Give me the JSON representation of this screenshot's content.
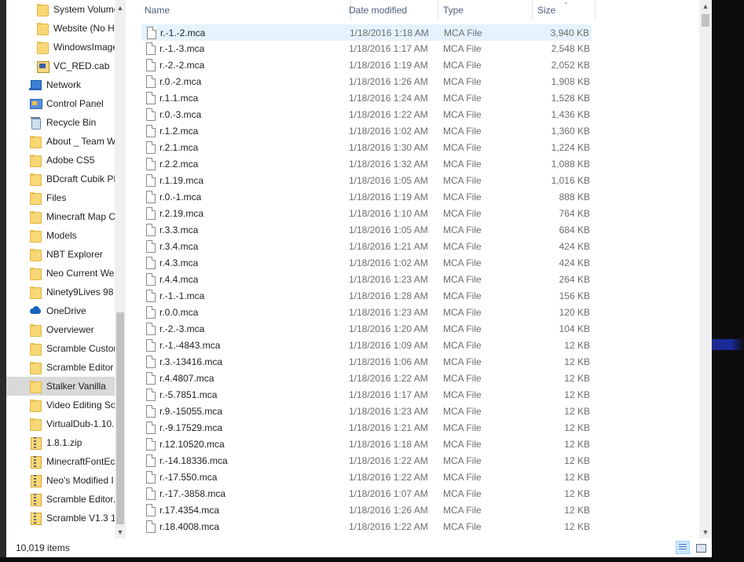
{
  "nav": {
    "items": [
      {
        "label": "System Volume",
        "icon": "folder-icon",
        "indent": 2
      },
      {
        "label": "Website (No H",
        "icon": "folder-icon",
        "indent": 2
      },
      {
        "label": "WindowsImage",
        "icon": "folder-icon",
        "indent": 2
      },
      {
        "label": "VC_RED.cab",
        "icon": "cab-file-icon",
        "indent": 2
      },
      {
        "label": "Network",
        "icon": "network-icon",
        "indent": 1
      },
      {
        "label": "Control Panel",
        "icon": "control-panel-icon",
        "indent": 1
      },
      {
        "label": "Recycle Bin",
        "icon": "recycle-bin-icon",
        "indent": 1
      },
      {
        "label": "About _ Team W",
        "icon": "folder-icon",
        "indent": 1
      },
      {
        "label": "Adobe CS5",
        "icon": "folder-icon",
        "indent": 1
      },
      {
        "label": "BDcraft Cubik PF",
        "icon": "folder-icon",
        "indent": 1
      },
      {
        "label": "Files",
        "icon": "folder-icon",
        "indent": 1
      },
      {
        "label": "Minecraft Map C",
        "icon": "folder-icon",
        "indent": 1
      },
      {
        "label": "Models",
        "icon": "folder-icon",
        "indent": 1
      },
      {
        "label": "NBT Explorer",
        "icon": "folder-icon",
        "indent": 1
      },
      {
        "label": "Neo Current We",
        "icon": "folder-icon",
        "indent": 1
      },
      {
        "label": "Ninety9Lives 98",
        "icon": "folder-icon",
        "indent": 1
      },
      {
        "label": "OneDrive",
        "icon": "onedrive-icon",
        "indent": 1
      },
      {
        "label": "Overviewer",
        "icon": "folder-icon",
        "indent": 1
      },
      {
        "label": "Scramble Custor",
        "icon": "folder-icon",
        "indent": 1
      },
      {
        "label": "Scramble Editor",
        "icon": "folder-icon",
        "indent": 1
      },
      {
        "label": "Stalker Vanilla",
        "icon": "folder-icon",
        "indent": 1,
        "selected": true
      },
      {
        "label": "Video Editing So",
        "icon": "folder-icon",
        "indent": 1
      },
      {
        "label": "VirtualDub-1.10.",
        "icon": "folder-icon",
        "indent": 1
      },
      {
        "label": "1.8.1.zip",
        "icon": "zip-icon",
        "indent": 1
      },
      {
        "label": "MinecraftFontEc",
        "icon": "zip-icon",
        "indent": 1
      },
      {
        "label": "Neo's Modified I",
        "icon": "zip-icon",
        "indent": 1
      },
      {
        "label": "Scramble Editor.",
        "icon": "zip-icon",
        "indent": 1
      },
      {
        "label": "Scramble V1.3 1.",
        "icon": "zip-icon",
        "indent": 1
      }
    ]
  },
  "columns": {
    "name": "Name",
    "date": "Date modified",
    "type": "Type",
    "size": "Size"
  },
  "files": [
    {
      "name": "r.-1.-2.mca",
      "date": "1/18/2016 1:18 AM",
      "type": "MCA File",
      "size": "3,940 KB",
      "selected": true
    },
    {
      "name": "r.-1.-3.mca",
      "date": "1/18/2016 1:17 AM",
      "type": "MCA File",
      "size": "2,548 KB"
    },
    {
      "name": "r.-2.-2.mca",
      "date": "1/18/2016 1:19 AM",
      "type": "MCA File",
      "size": "2,052 KB"
    },
    {
      "name": "r.0.-2.mca",
      "date": "1/18/2016 1:26 AM",
      "type": "MCA File",
      "size": "1,908 KB"
    },
    {
      "name": "r.1.1.mca",
      "date": "1/18/2016 1:24 AM",
      "type": "MCA File",
      "size": "1,528 KB"
    },
    {
      "name": "r.0.-3.mca",
      "date": "1/18/2016 1:22 AM",
      "type": "MCA File",
      "size": "1,436 KB"
    },
    {
      "name": "r.1.2.mca",
      "date": "1/18/2016 1:02 AM",
      "type": "MCA File",
      "size": "1,360 KB"
    },
    {
      "name": "r.2.1.mca",
      "date": "1/18/2016 1:30 AM",
      "type": "MCA File",
      "size": "1,224 KB"
    },
    {
      "name": "r.2.2.mca",
      "date": "1/18/2016 1:32 AM",
      "type": "MCA File",
      "size": "1,088 KB"
    },
    {
      "name": "r.1.19.mca",
      "date": "1/18/2016 1:05 AM",
      "type": "MCA File",
      "size": "1,016 KB"
    },
    {
      "name": "r.0.-1.mca",
      "date": "1/18/2016 1:19 AM",
      "type": "MCA File",
      "size": "888 KB"
    },
    {
      "name": "r.2.19.mca",
      "date": "1/18/2016 1:10 AM",
      "type": "MCA File",
      "size": "764 KB"
    },
    {
      "name": "r.3.3.mca",
      "date": "1/18/2016 1:05 AM",
      "type": "MCA File",
      "size": "684 KB"
    },
    {
      "name": "r.3.4.mca",
      "date": "1/18/2016 1:21 AM",
      "type": "MCA File",
      "size": "424 KB"
    },
    {
      "name": "r.4.3.mca",
      "date": "1/18/2016 1:02 AM",
      "type": "MCA File",
      "size": "424 KB"
    },
    {
      "name": "r.4.4.mca",
      "date": "1/18/2016 1:23 AM",
      "type": "MCA File",
      "size": "264 KB"
    },
    {
      "name": "r.-1.-1.mca",
      "date": "1/18/2016 1:28 AM",
      "type": "MCA File",
      "size": "156 KB"
    },
    {
      "name": "r.0.0.mca",
      "date": "1/18/2016 1:23 AM",
      "type": "MCA File",
      "size": "120 KB"
    },
    {
      "name": "r.-2.-3.mca",
      "date": "1/18/2016 1:20 AM",
      "type": "MCA File",
      "size": "104 KB"
    },
    {
      "name": "r.-1.-4843.mca",
      "date": "1/18/2016 1:09 AM",
      "type": "MCA File",
      "size": "12 KB"
    },
    {
      "name": "r.3.-13416.mca",
      "date": "1/18/2016 1:06 AM",
      "type": "MCA File",
      "size": "12 KB"
    },
    {
      "name": "r.4.4807.mca",
      "date": "1/18/2016 1:22 AM",
      "type": "MCA File",
      "size": "12 KB"
    },
    {
      "name": "r.-5.7851.mca",
      "date": "1/18/2016 1:17 AM",
      "type": "MCA File",
      "size": "12 KB"
    },
    {
      "name": "r.9.-15055.mca",
      "date": "1/18/2016 1:23 AM",
      "type": "MCA File",
      "size": "12 KB"
    },
    {
      "name": "r.-9.17529.mca",
      "date": "1/18/2016 1:21 AM",
      "type": "MCA File",
      "size": "12 KB"
    },
    {
      "name": "r.12.10520.mca",
      "date": "1/18/2016 1:18 AM",
      "type": "MCA File",
      "size": "12 KB"
    },
    {
      "name": "r.-14.18336.mca",
      "date": "1/18/2016 1:22 AM",
      "type": "MCA File",
      "size": "12 KB"
    },
    {
      "name": "r.-17.550.mca",
      "date": "1/18/2016 1:22 AM",
      "type": "MCA File",
      "size": "12 KB"
    },
    {
      "name": "r.-17.-3858.mca",
      "date": "1/18/2016 1:07 AM",
      "type": "MCA File",
      "size": "12 KB"
    },
    {
      "name": "r.17.4354.mca",
      "date": "1/18/2016 1:26 AM",
      "type": "MCA File",
      "size": "12 KB"
    },
    {
      "name": "r.18.4008.mca",
      "date": "1/18/2016 1:22 AM",
      "type": "MCA File",
      "size": "12 KB"
    }
  ],
  "status": {
    "item_count": "10,019 items"
  },
  "colors": {
    "selection": "#e5f3ff",
    "nav_selected": "#d9d9d9",
    "header_text": "#4c607a"
  }
}
